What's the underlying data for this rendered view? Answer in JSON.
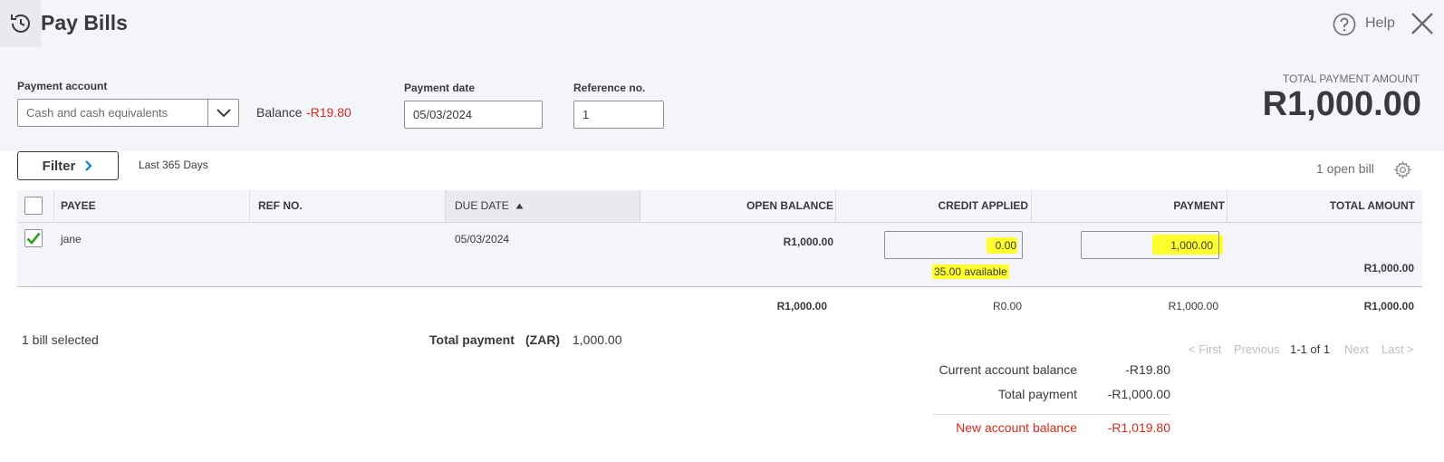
{
  "page": {
    "title": "Pay Bills",
    "help_label": "Help"
  },
  "payment_account": {
    "label": "Payment account",
    "selected": "Cash and cash equivalents",
    "balance_label": "Balance",
    "balance_value": "-R19.80"
  },
  "payment_date": {
    "label": "Payment date",
    "value": "05/03/2024"
  },
  "reference": {
    "label": "Reference no.",
    "value": "1"
  },
  "total_payment_amount": {
    "label": "TOTAL PAYMENT AMOUNT",
    "value": "R1,000.00"
  },
  "filter": {
    "label": "Filter",
    "range": "Last 365 Days",
    "open_bills": "1 open bill"
  },
  "table": {
    "columns": {
      "payee": "PAYEE",
      "ref": "REF NO.",
      "due_date": "DUE DATE",
      "open_balance": "OPEN BALANCE",
      "credit_applied": "CREDIT APPLIED",
      "payment": "PAYMENT",
      "total_amount": "TOTAL AMOUNT"
    },
    "rows": [
      {
        "checked": true,
        "payee": "jane",
        "ref": "",
        "due_date": "05/03/2024",
        "open_balance": "R1,000.00",
        "credit_applied": "0.00",
        "credit_available": "35.00 available",
        "payment": "1,000.00",
        "total_amount": "R1,000.00"
      }
    ],
    "totals": {
      "open_balance": "R1,000.00",
      "credit_applied": "R0.00",
      "payment": "R1,000.00",
      "total_amount": "R1,000.00"
    }
  },
  "footer": {
    "bills_selected": "1 bill selected",
    "total_payment_label": "Total payment",
    "currency": "(ZAR)",
    "total_payment_value": "1,000.00",
    "pagination": {
      "first": "< First",
      "previous": "Previous",
      "range": "1-1 of 1",
      "next": "Next",
      "last": "Last >"
    }
  },
  "summary": {
    "current_balance_label": "Current account balance",
    "current_balance_value": "-R19.80",
    "total_payment_label": "Total payment",
    "total_payment_value": "-R1,000.00",
    "new_balance_label": "New account balance",
    "new_balance_value": "-R1,019.80"
  },
  "colors": {
    "negative": "#d52b1e",
    "highlight": "#ffff2e",
    "check": "#2ca01c",
    "band": "#f4f5f8"
  }
}
